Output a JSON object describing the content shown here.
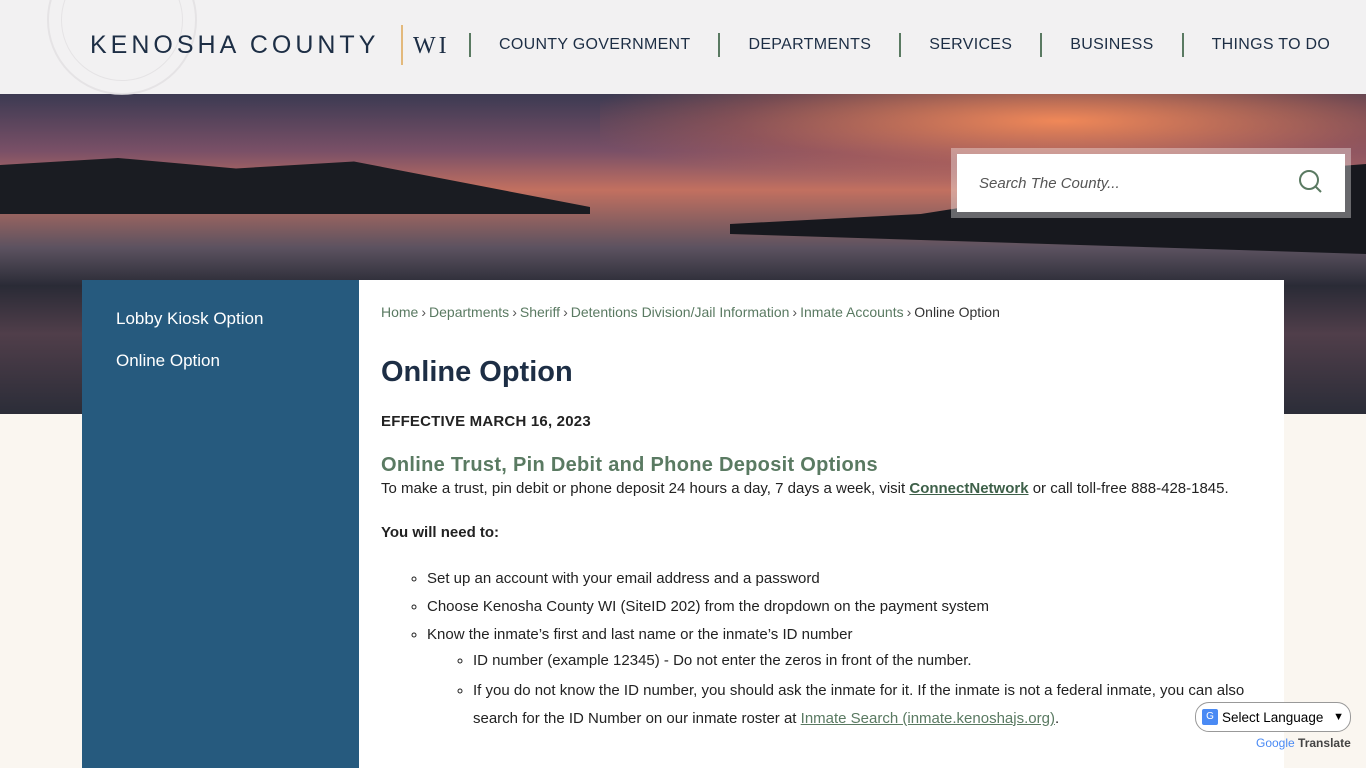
{
  "header": {
    "logo": "KENOSHA COUNTY",
    "logo_state": "WI",
    "nav": [
      "COUNTY GOVERNMENT",
      "DEPARTMENTS",
      "SERVICES",
      "BUSINESS",
      "THINGS TO DO"
    ]
  },
  "search": {
    "placeholder": "Search The County..."
  },
  "sidebar": {
    "items": [
      "Lobby Kiosk Option",
      "Online Option"
    ]
  },
  "breadcrumb": [
    "Home",
    "Departments",
    "Sheriff",
    "Detentions Division/Jail Information",
    "Inmate Accounts"
  ],
  "breadcrumb_current": "Online Option",
  "main": {
    "title": "Online Option",
    "effective": "EFFECTIVE MARCH 16, 2023",
    "heading": "Online Trust, Pin Debit and Phone Deposit Options",
    "intro_pre": "To make a trust, pin debit or phone deposit 24 hours a day, 7 days a week, visit ",
    "intro_link": "ConnectNetwork",
    "intro_post": " or call toll-free 888-428-1845.",
    "need": "You will need to:",
    "bullets": [
      "Set up an account with your email address and a password",
      "Choose Kenosha County WI (SiteID 202) from the dropdown on the payment system",
      "Know the inmate’s first and last name or the inmate’s ID number"
    ],
    "sub_bullets": [
      "ID number (example 12345) - Do not enter the zeros in front of the number.",
      "If you do not know the ID number, you should ask the inmate for it. If the inmate is not a federal inmate, you can also search for the ID Number on our inmate roster at "
    ],
    "sub_link": "Inmate Search (inmate.kenoshajs.org)",
    "sub_post": "."
  },
  "translate": {
    "select": "Select Language",
    "powered_by": "Google",
    "label": "Translate"
  }
}
